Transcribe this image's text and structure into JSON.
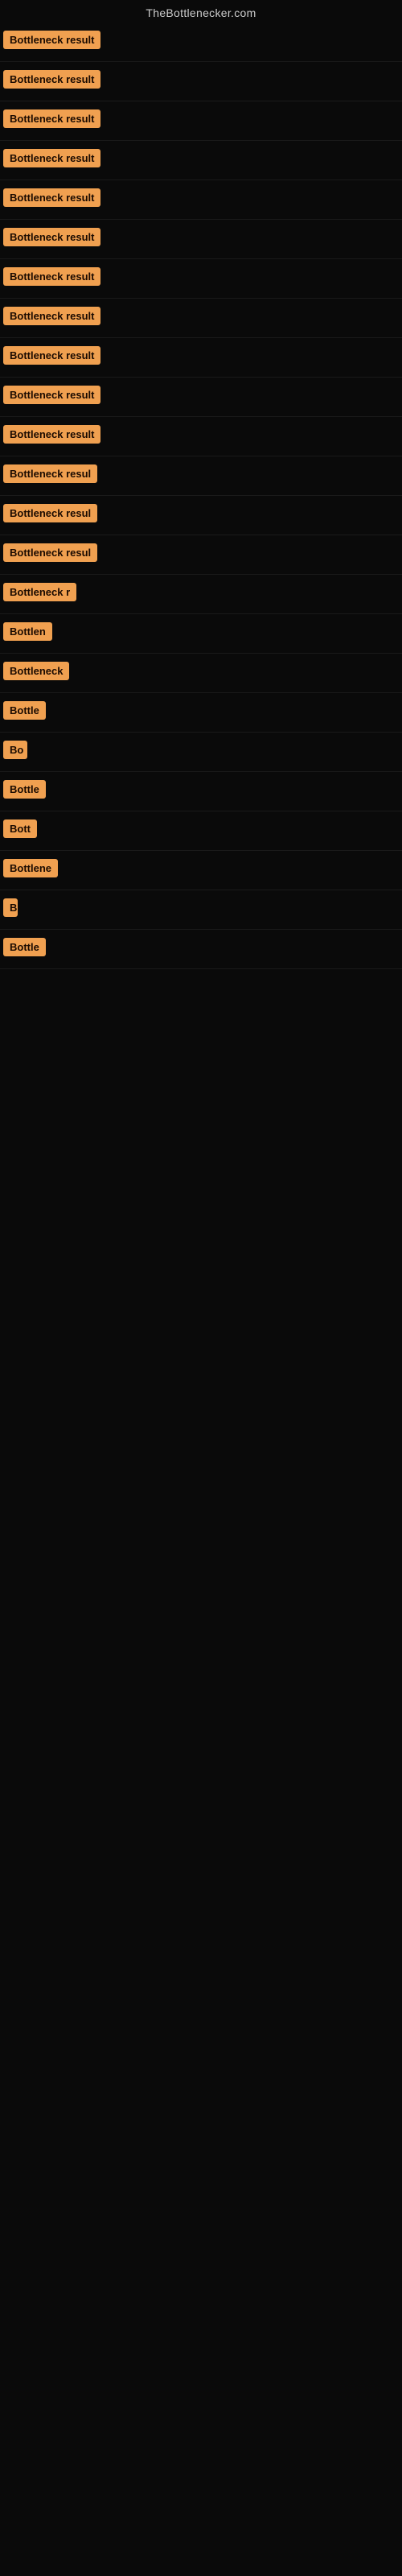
{
  "site": {
    "title": "TheBottlenecker.com"
  },
  "results": [
    {
      "id": 1,
      "label": "Bottleneck result",
      "width": 160
    },
    {
      "id": 2,
      "label": "Bottleneck result",
      "width": 160
    },
    {
      "id": 3,
      "label": "Bottleneck result",
      "width": 160
    },
    {
      "id": 4,
      "label": "Bottleneck result",
      "width": 160
    },
    {
      "id": 5,
      "label": "Bottleneck result",
      "width": 160
    },
    {
      "id": 6,
      "label": "Bottleneck result",
      "width": 160
    },
    {
      "id": 7,
      "label": "Bottleneck result",
      "width": 160
    },
    {
      "id": 8,
      "label": "Bottleneck result",
      "width": 155
    },
    {
      "id": 9,
      "label": "Bottleneck result",
      "width": 155
    },
    {
      "id": 10,
      "label": "Bottleneck result",
      "width": 155
    },
    {
      "id": 11,
      "label": "Bottleneck result",
      "width": 155
    },
    {
      "id": 12,
      "label": "Bottleneck resul",
      "width": 148
    },
    {
      "id": 13,
      "label": "Bottleneck resul",
      "width": 145
    },
    {
      "id": 14,
      "label": "Bottleneck resul",
      "width": 142
    },
    {
      "id": 15,
      "label": "Bottleneck r",
      "width": 115
    },
    {
      "id": 16,
      "label": "Bottlen",
      "width": 80
    },
    {
      "id": 17,
      "label": "Bottleneck",
      "width": 95
    },
    {
      "id": 18,
      "label": "Bottle",
      "width": 70
    },
    {
      "id": 19,
      "label": "Bo",
      "width": 30
    },
    {
      "id": 20,
      "label": "Bottle",
      "width": 68
    },
    {
      "id": 21,
      "label": "Bott",
      "width": 48
    },
    {
      "id": 22,
      "label": "Bottlene",
      "width": 82
    },
    {
      "id": 23,
      "label": "B",
      "width": 18
    },
    {
      "id": 24,
      "label": "Bottle",
      "width": 68
    }
  ]
}
